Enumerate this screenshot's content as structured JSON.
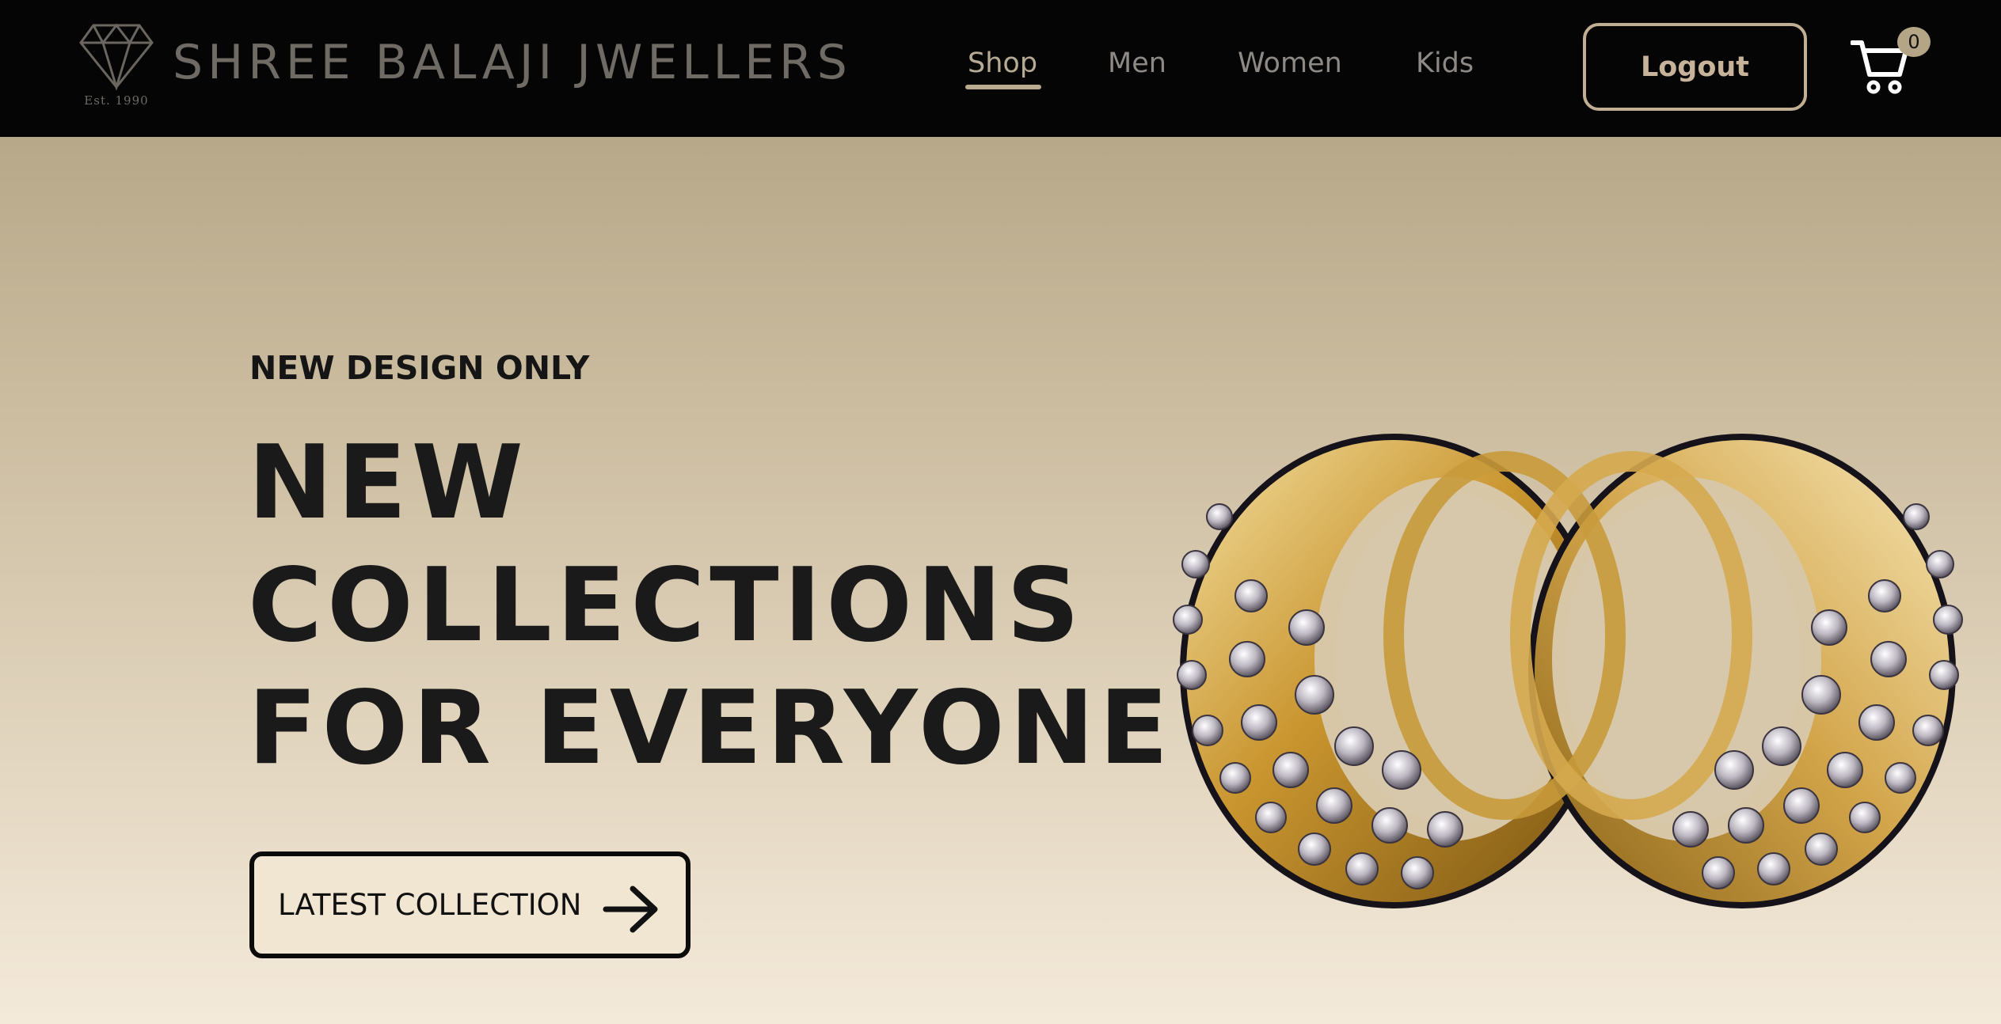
{
  "header": {
    "logo_est": "Est. 1990",
    "brand": "SHREE BALAJI JWELLERS",
    "nav": [
      {
        "label": "Shop",
        "active": true
      },
      {
        "label": "Men",
        "active": false
      },
      {
        "label": "Women",
        "active": false
      },
      {
        "label": "Kids",
        "active": false
      }
    ],
    "logout_label": "Logout",
    "cart_icon": "cart-icon",
    "cart_count": "0"
  },
  "hero": {
    "eyebrow": "NEW DESIGN ONLY",
    "headline": [
      "NEW",
      "COLLECTIONS",
      "FOR EVERYONE"
    ],
    "cta_label": "LATEST COLLECTION",
    "cta_icon": "arrow-right-icon",
    "image": "diamond-rings-image"
  },
  "colors": {
    "navbar": "#050505",
    "accent": "#c1ae93",
    "hero_top": "#b8a88a",
    "hero_bottom": "#f4eada",
    "text_dark": "#1a1a1a"
  }
}
